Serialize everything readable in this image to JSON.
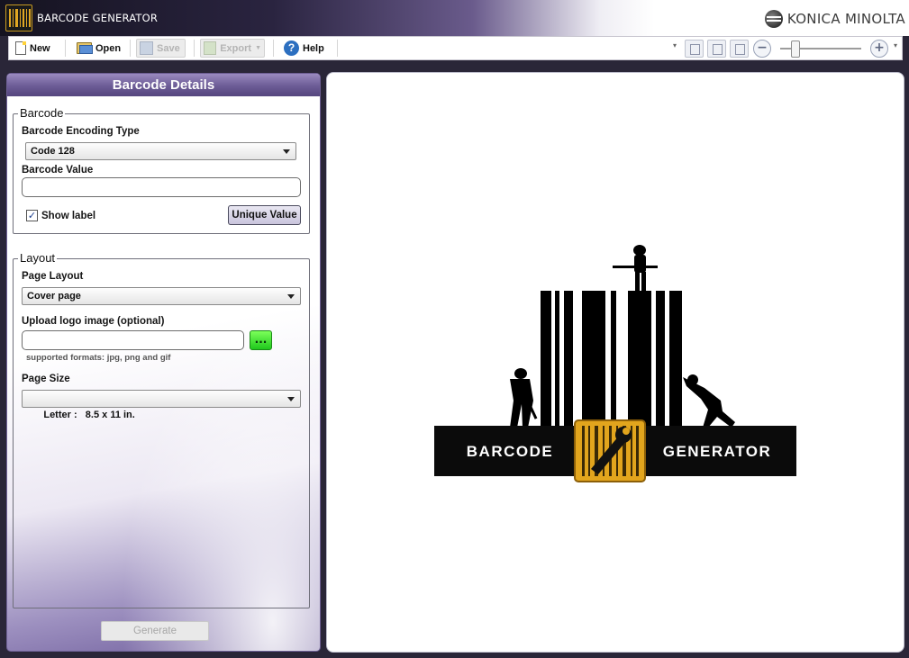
{
  "app": {
    "title": "BARCODE GENERATOR",
    "brand": "KONICA MINOLTA"
  },
  "toolbar": {
    "new_label": "New",
    "open_label": "Open",
    "save_label": "Save",
    "export_label": "Export",
    "help_label": "Help",
    "help_icon_glyph": "?",
    "zoom_out_glyph": "−",
    "zoom_in_glyph": "+"
  },
  "panel": {
    "title": "Barcode Details",
    "barcode": {
      "legend": "Barcode",
      "encoding_label": "Barcode Encoding Type",
      "encoding_value": "Code 128",
      "value_label": "Barcode Value",
      "value": "",
      "show_label_text": "Show label",
      "show_label_checked_glyph": "✓",
      "unique_value_button": "Unique Value"
    },
    "layout": {
      "legend": "Layout",
      "page_layout_label": "Page Layout",
      "page_layout_value": "Cover page",
      "logo_label": "Upload logo image (optional)",
      "logo_value": "",
      "browse_button": "...",
      "formats_hint": "supported formats: jpg, png and gif",
      "page_size_label": "Page Size",
      "page_size_value": "Letter :   8.5 x 11 in."
    },
    "generate_button": "Generate"
  },
  "preview": {
    "logo_left_text": "BARCODE",
    "logo_right_text": "GENERATOR"
  }
}
